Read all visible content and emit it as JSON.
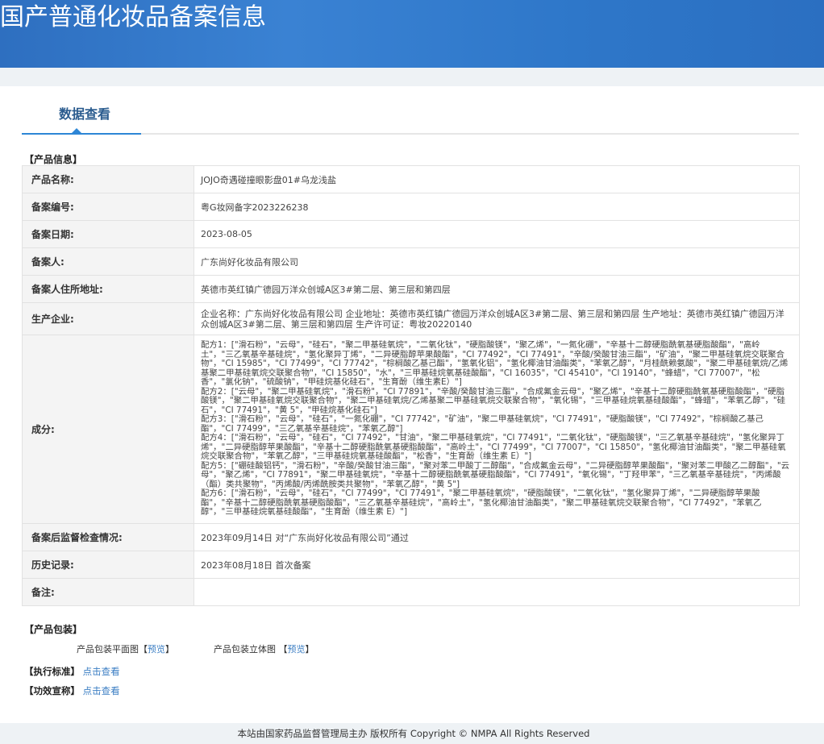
{
  "header": {
    "title": "国产普通化妆品备案信息"
  },
  "tabs": [
    {
      "label": "数据查看",
      "active": true
    }
  ],
  "product_info": {
    "section_title": "【产品信息】",
    "rows": [
      {
        "label": "产品名称:",
        "value": "JOJO奇遇碰撞眼影盘01#乌龙浅盐"
      },
      {
        "label": "备案编号:",
        "value": "粤G妆网备字2023226238"
      },
      {
        "label": "备案日期:",
        "value": "2023-08-05"
      },
      {
        "label": "备案人:",
        "value": "广东尚好化妆品有限公司"
      },
      {
        "label": "备案人住所地址:",
        "value": "英德市英红镇广德园万洋众创城A区3#第二层、第三层和第四层"
      },
      {
        "label": "生产企业:",
        "value": "企业名称：广东尚好化妆品有限公司 企业地址：英德市英红镇广德园万洋众创城A区3#第二层、第三层和第四层 生产地址：英德市英红镇广德园万洋众创城A区3#第二层、第三层和第四层 生产许可证：粤妆20220140"
      },
      {
        "label": "成分:",
        "formulas": [
          "配方1：[\"滑石粉\"，\"云母\"，\"硅石\"，\"聚二甲基硅氧烷\"，\"二氧化钛\"，\"硬脂酸镁\"，\"聚乙烯\"，\"一氮化硼\"，\"辛基十二醇硬脂酰氧基硬脂酸酯\"，\"高岭土\"，\"三乙氧基辛基硅烷\"，\"氢化聚异丁烯\"，\"二异硬脂醇苹果酸酯\"，\"CI 77492\"，\"CI 77491\"，\"辛酸/癸酸甘油三酯\"，\"矿油\"，\"聚二甲基硅氧烷交联聚合物\"，\"CI 15985\"，\"CI 77499\"，\"CI 77742\"，\"棕榈酸乙基己酯\"，\"氢氧化铝\"，\"氢化椰油甘油酯类\"，\"苯氧乙醇\"，\"月桂酰赖氨酸\"，\"聚二甲基硅氧烷/乙烯基聚二甲基硅氧烷交联聚合物\"，\"CI 15850\"，\"水\"，\"三甲基硅烷氧基硅酸酯\"，\"CI 16035\"，\"CI 45410\"，\"CI 19140\"，\"蜂蜡\"，\"CI 77007\"，\"松香\"，\"氯化钠\"，\"硫酸钠\"，\"甲硅烷基化硅石\"，\"生育酚（维生素E）\"]",
          "配方2：[\"云母\"，\"聚二甲基硅氧烷\"，\"滑石粉\"，\"CI 77891\"，\"辛酸/癸酸甘油三酯\"，\"合成氟金云母\"，\"聚乙烯\"，\"辛基十二醇硬脂酰氧基硬脂酸酯\"，\"硬脂酸镁\"，\"聚二甲基硅氧烷交联聚合物\"，\"聚二甲基硅氧烷/乙烯基聚二甲基硅氧烷交联聚合物\"，\"氧化锡\"，\"三甲基硅烷氧基硅酸酯\"，\"蜂蜡\"，\"苯氧乙醇\"，\"硅石\"，\"CI 77491\"，\"黄 5\"，\"甲硅烷基化硅石\"]",
          "配方3：[\"滑石粉\"，\"云母\"，\"硅石\"，\"一氮化硼\"，\"CI 77742\"，\"矿油\"，\"聚二甲基硅氧烷\"，\"CI 77491\"，\"硬脂酸镁\"，\"CI 77492\"，\"棕榈酸乙基己酯\"，\"CI 77499\"，\"三乙氧基辛基硅烷\"，\"苯氧乙醇\"]",
          "配方4：[\"滑石粉\"，\"云母\"，\"硅石\"，\"CI 77492\"，\"甘油\"，\"聚二甲基硅氧烷\"，\"CI 77491\"，\"二氧化钛\"，\"硬脂酸镁\"，\"三乙氧基辛基硅烷\"，\"氢化聚异丁烯\"，\"二异硬脂醇苹果酸酯\"，\"辛基十二醇硬脂酰氧基硬脂酸酯\"，\"高岭土\"，\"CI 77499\"，\"CI 77007\"，\"CI 15850\"，\"氢化椰油甘油酯类\"，\"聚二甲基硅氧烷交联聚合物\"，\"苯氧乙醇\"，\"三甲基硅烷氧基硅酸酯\"，\"松香\"，\"生育酚（维生素 E）\"]",
          "配方5：[\"硼硅酸铝钙\"，\"滑石粉\"，\"辛酸/癸酸甘油三酯\"，\"聚对苯二甲酸丁二醇酯\"，\"合成氟金云母\"，\"二异硬脂醇苹果酸酯\"，\"聚对苯二甲酸乙二醇酯\"，\"云母\"，\"聚乙烯\"，\"CI 77891\"，\"聚二甲基硅氧烷\"，\"辛基十二醇硬脂酰氧基硬脂酸酯\"，\"CI 77491\"，\"氧化锡\"，\"丁羟甲苯\"，\"三乙氧基辛基硅烷\"，\"丙烯酸（酯）类共聚物\"，\"丙烯酸/丙烯酰胺类共聚物\"，\"苯氧乙醇\"，\"黄 5\"]",
          "配方6：[\"滑石粉\"，\"云母\"，\"硅石\"，\"CI 77499\"，\"CI 77491\"，\"聚二甲基硅氧烷\"，\"硬脂酸镁\"，\"二氧化钛\"，\"氢化聚异丁烯\"，\"二异硬脂醇苹果酸酯\"，\"辛基十二醇硬脂酰氧基硬脂酸酯\"，\"三乙氧基辛基硅烷\"，\"高岭土\"，\"氢化椰油甘油酯类\"，\"聚二甲基硅氧烷交联聚合物\"，\"CI 77492\"，\"苯氧乙醇\"，\"三甲基硅烷氧基硅酸酯\"，\"生育酚（维生素 E）\"]"
        ]
      },
      {
        "label": "备案后监督检查情况:",
        "value": "2023年09月14日 对“广东尚好化妆品有限公司”通过"
      },
      {
        "label": "历史记录:",
        "value": "2023年08月18日 首次备案"
      },
      {
        "label": "备注:",
        "value": ""
      }
    ]
  },
  "packaging": {
    "section_title": "【产品包装】",
    "flat_label": "产品包装平面图",
    "stereo_label": "产品包装立体图",
    "bracket_open": "【",
    "bracket_close": "】",
    "preview": "预览"
  },
  "standard": {
    "label": "【执行标准】",
    "link": "点击查看"
  },
  "efficacy": {
    "label": "【功效宣称】",
    "link": "点击查看"
  },
  "footer": {
    "text": "本站由国家药品监督管理局主办 版权所有 Copyright © NMPA All Rights Reserved"
  },
  "colors": {
    "banner": "#2e77c9",
    "accent": "#2d86d6",
    "link": "#3d7fc4"
  }
}
